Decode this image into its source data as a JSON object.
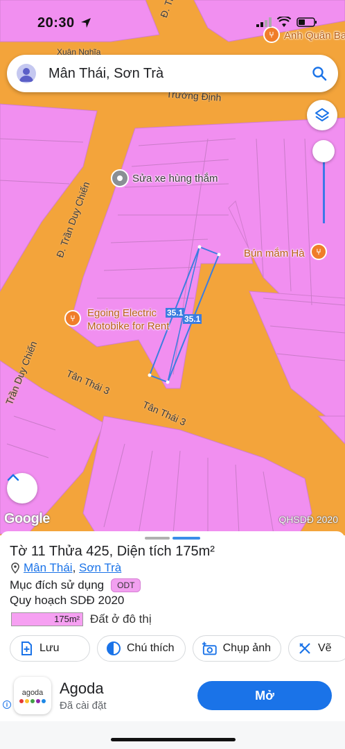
{
  "status_bar": {
    "time": "20:30"
  },
  "search": {
    "query": "Mân Thái, Sơn Trà"
  },
  "map": {
    "street_labels": {
      "tran_d_top": "Đ. Trần D",
      "xuan_nghia": "Xuân Nghĩa",
      "truong_dinh": "Trường Định",
      "tran_duy_chien_1": "Đ. Trần Duy Chiến",
      "tran_duy_chien_2": "Trần Duy Chiến",
      "tan_thai_3_a": "Tân Thái 3",
      "tan_thai_3_b": "Tân Thái 3"
    },
    "pois": {
      "anh_quan": "Anh Quân Ba",
      "sua_xe": "Sửa xe hùng thắm",
      "bun_mam": "Bún mắm Hà",
      "egoing_line1": "Egoing Electric",
      "egoing_line2": "Motobike for Rent"
    },
    "dimension_labels": [
      "35.1",
      "35.1"
    ],
    "attribution": {
      "google": "Google",
      "layer": "QHSDĐ 2020"
    },
    "colors": {
      "road": "#f3a43b",
      "residential": "#f18ff0",
      "parcel_line": "#3b7de0"
    }
  },
  "parcel": {
    "title": "Tờ 11 Thửa 425, Diện tích 175m²",
    "location_a": "Mân Thái",
    "location_sep": ",",
    "location_b": "Sơn Trà",
    "purpose_label": "Mục đích sử dụng",
    "purpose_code": "ODT",
    "plan_label": "Quy hoạch SDĐ 2020",
    "legend_area": "175m²",
    "legend_text": "Đất ở đô thị"
  },
  "actions": [
    {
      "label": "Lưu",
      "icon": "add-bookmark-icon"
    },
    {
      "label": "Chú thích",
      "icon": "half-circle-icon"
    },
    {
      "label": "Chụp ảnh",
      "icon": "add-photo-icon"
    },
    {
      "label": "Vẽ",
      "icon": "ruler-pencil-icon"
    }
  ],
  "ad": {
    "icon_word": "agoda",
    "title": "Agoda",
    "subtitle": "Đã cài đặt",
    "button": "Mở",
    "info": "i"
  }
}
